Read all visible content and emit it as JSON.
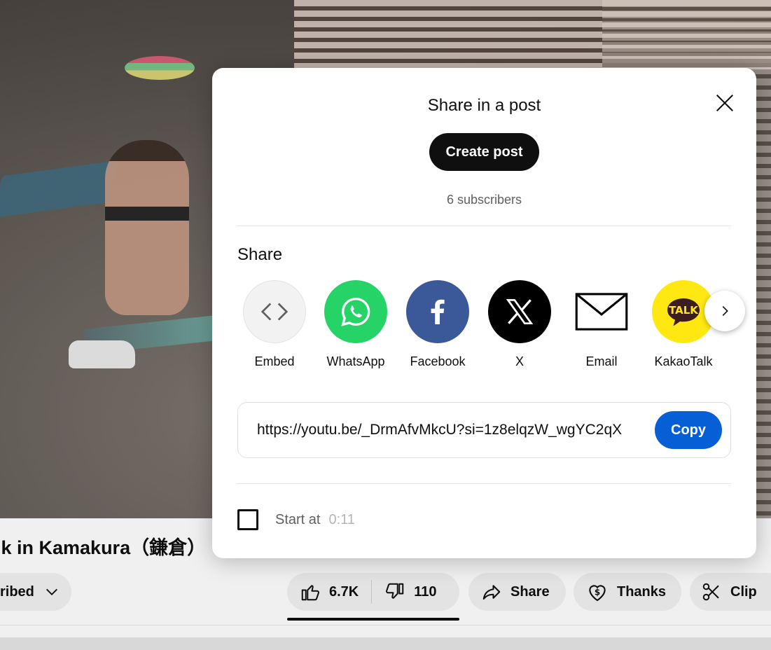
{
  "video": {
    "title": "lk in Kamakura（鎌倉）",
    "subscribed_label": "ribed",
    "likes": "6.7K",
    "dislikes": "110",
    "share_label": "Share",
    "thanks_label": "Thanks",
    "clip_label": "Clip"
  },
  "dialog": {
    "title": "Share in a post",
    "create_post_label": "Create post",
    "subscribers": "6 subscribers",
    "share_section_label": "Share",
    "targets": [
      {
        "label": "Embed",
        "icon": "embed-icon",
        "color": "#f2f2f2"
      },
      {
        "label": "WhatsApp",
        "icon": "whatsapp-icon",
        "color": "#25d366"
      },
      {
        "label": "Facebook",
        "icon": "facebook-icon",
        "color": "#3b5998"
      },
      {
        "label": "X",
        "icon": "x-icon",
        "color": "#000000"
      },
      {
        "label": "Email",
        "icon": "email-icon",
        "color": "#ffffff"
      },
      {
        "label": "KakaoTalk",
        "icon": "kakaotalk-icon",
        "color": "#ffe812"
      }
    ],
    "kakao_badge": "TALK",
    "url": "https://youtu.be/_DrmAfvMkcU?si=1z8elqzW_wgYC2qX",
    "copy_label": "Copy",
    "start_at_label": "Start at",
    "start_at_time": "0:11"
  },
  "colors": {
    "copy_blue": "#065fd4",
    "dark": "#0f0f0f",
    "secondary_text": "#606060"
  }
}
